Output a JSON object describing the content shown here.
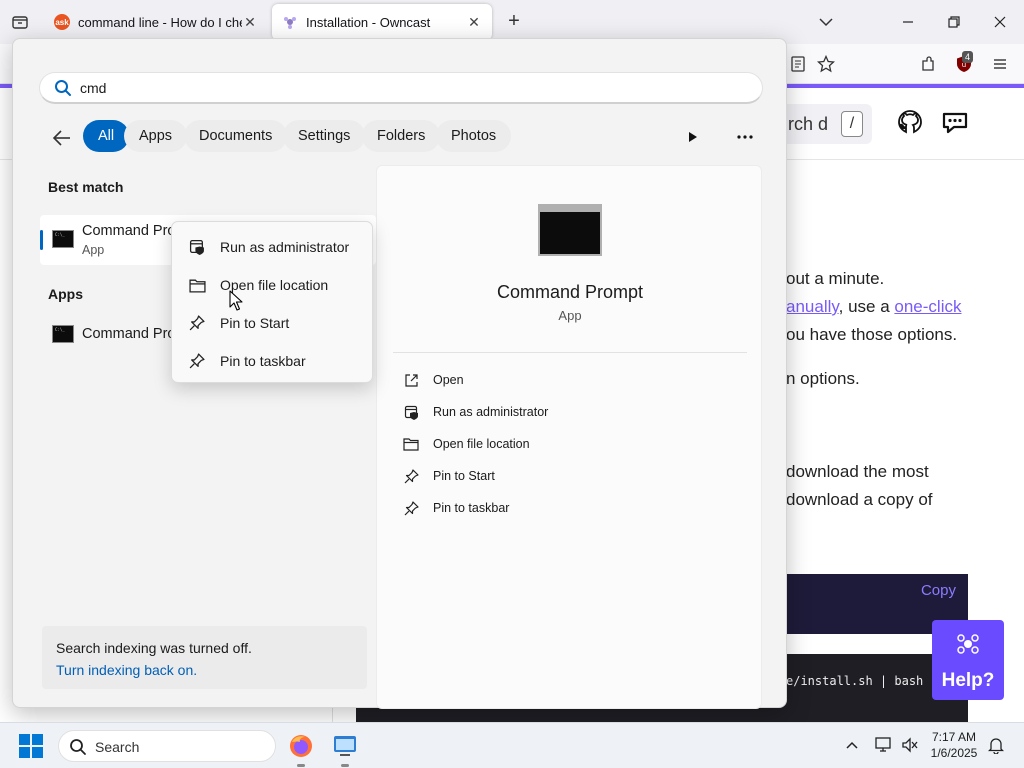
{
  "browser": {
    "tabs": [
      {
        "title": "command line - How do I chec",
        "favicon_text": "ask",
        "favicon_color": "#e95420"
      },
      {
        "title": "Installation - Owncast"
      }
    ],
    "new_tab": "+",
    "ublock_count": "4"
  },
  "page": {
    "search_text": "rch d",
    "search_key": "/",
    "lines": {
      "l1": "out a minute.",
      "l2_link1": "anually",
      "l2_mid": ", use a ",
      "l2_link2": "one-click",
      "l3": "ou have those options.",
      "l4": "n options.",
      "l5": "download the most",
      "l6": "download a copy of"
    },
    "copy_label": "Copy",
    "code_snippet": "e/install.sh | bash",
    "help_label": "Help?"
  },
  "flyout": {
    "search_value": "cmd",
    "filters": [
      "All",
      "Apps",
      "Documents",
      "Settings",
      "Folders",
      "Photos"
    ],
    "best_match_title": "Best match",
    "best_match": {
      "name": "Command Prompt",
      "type": "App"
    },
    "apps_title": "Apps",
    "apps": [
      {
        "name": "Command Prompt"
      }
    ],
    "footer_text": "Search indexing was turned off.",
    "footer_link": "Turn indexing back on.",
    "detail": {
      "title": "Command Prompt",
      "type": "App",
      "actions": [
        "Open",
        "Run as administrator",
        "Open file location",
        "Pin to Start",
        "Pin to taskbar"
      ]
    }
  },
  "context_menu": {
    "items": [
      "Run as administrator",
      "Open file location",
      "Pin to Start",
      "Pin to taskbar"
    ]
  },
  "taskbar": {
    "search_label": "Search",
    "time": "7:17 AM",
    "date": "1/6/2025"
  },
  "colors": {
    "accent": "#0067c0",
    "link": "#7a5af8"
  }
}
